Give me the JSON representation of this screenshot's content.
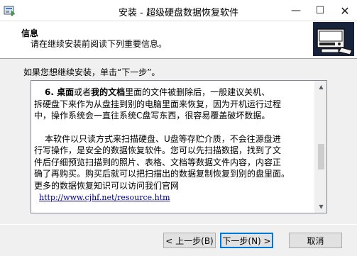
{
  "window": {
    "title": "安装 - 超级硬盘数据恢复软件",
    "minimize_glyph": "—",
    "maximize_glyph": "☐",
    "close_glyph": "✕"
  },
  "header": {
    "title": "信息",
    "subtitle": "请在继续安装前阅读下列重要信息。"
  },
  "intro": "如果您想继续安装，单击“下一步”。",
  "info_text": {
    "p1_prefix": "6. ",
    "p1_bold1": "桌面",
    "p1_mid": "或者",
    "p1_bold2": "我的文档",
    "p1_rest1": "里面的文件被删除后，一般建议关机、",
    "p1_line2": "拆硬盘下来作为从盘挂到别的电脑里面来恢复，因为开机运行过程",
    "p1_line3": "中，操作系统会一直往系统C盘写东西，很容易覆盖破坏数据。",
    "p2_line1": "本软件以只读方式来扫描硬盘、U盘等存贮介质，不会往源盘进",
    "p2_line2": "行写操作，是安全的数据恢复软件。您可以先扫描数据，找到了文",
    "p2_line3": "件后仔细预览扫描到的照片、表格、文档等数据文件内容，内容正",
    "p2_line4": "确了再购买。购买后就可以把扫描出的数据复制恢复到别的盘里面。",
    "p2_line5": "更多的数据恢复知识可以访问我们官网",
    "link": "http://www.cjhf.net/resource.htm"
  },
  "scrollbar": {
    "up_glyph": "▲",
    "down_glyph": "▼",
    "position": 0.62
  },
  "buttons": {
    "back": "< 上一步(B)",
    "next": "下一步(N) >",
    "cancel": "取消"
  },
  "icons": {
    "app": "setup-installer-icon",
    "logo": "hard-disk-recovery-logo"
  },
  "colors": {
    "accent": "#0078d7",
    "link": "#00007f"
  }
}
